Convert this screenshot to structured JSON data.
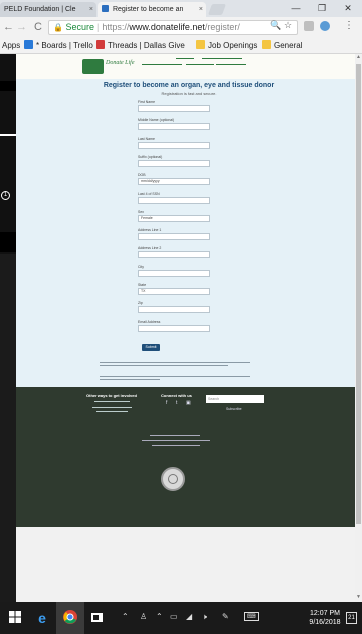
{
  "browser": {
    "tabs": [
      {
        "label": "PELD Foundation | Cle",
        "close": "×"
      },
      {
        "label": "Register to become an",
        "close": "×"
      }
    ],
    "window_controls": {
      "minimize": "—",
      "restore": "❐",
      "close": "✕"
    },
    "toolbar": {
      "back": "←",
      "forward": "→",
      "reload": "C",
      "lock_icon": "🔒",
      "secure_label": "Secure",
      "url_scheme": "https://",
      "url_host": "www.donatelife.net",
      "url_path": "/register/",
      "search_icon": "🔍",
      "star_icon": "☆"
    },
    "bookmarks": [
      {
        "label": "Apps",
        "icon": "apps-icon"
      },
      {
        "label": "* Boards | Trello",
        "icon": "trello-icon"
      },
      {
        "label": "Threads | Dallas Give",
        "icon": "threads-icon"
      },
      {
        "label": "Job Openings",
        "icon": "folder-icon"
      },
      {
        "label": "General",
        "icon": "folder-icon"
      }
    ]
  },
  "page": {
    "logo_text": "Donate Life",
    "form": {
      "title": "Register to become an organ, eye and tissue donor",
      "subtitle": "Registration is fast and secure.",
      "fields": [
        {
          "label": "First Name",
          "value": ""
        },
        {
          "label": "Middle Name (optional)",
          "value": ""
        },
        {
          "label": "Last Name",
          "value": ""
        },
        {
          "label": "Suffix (optional)",
          "value": ""
        },
        {
          "label": "DOB",
          "value": "mm/dd/yyyy"
        },
        {
          "label": "Last 4 of SSN",
          "value": ""
        },
        {
          "label": "Sex",
          "value": "Female"
        },
        {
          "label": "Address Line 1",
          "value": ""
        },
        {
          "label": "Address Line 2",
          "value": ""
        },
        {
          "label": "City",
          "value": ""
        },
        {
          "label": "State",
          "value": "TX"
        },
        {
          "label": "Zip",
          "value": ""
        },
        {
          "label": "Email Address",
          "value": ""
        }
      ],
      "submit_label": "Submit"
    },
    "footer": {
      "col1_heading": "Other ways to get involved",
      "col2_heading": "Connect with us",
      "search_placeholder": "Search",
      "subscribe": "Subscribe",
      "social": [
        "f",
        "t",
        "▣"
      ]
    }
  },
  "taskbar": {
    "time": "12:07 PM",
    "date": "9/16/2018",
    "notification_count": "21"
  }
}
